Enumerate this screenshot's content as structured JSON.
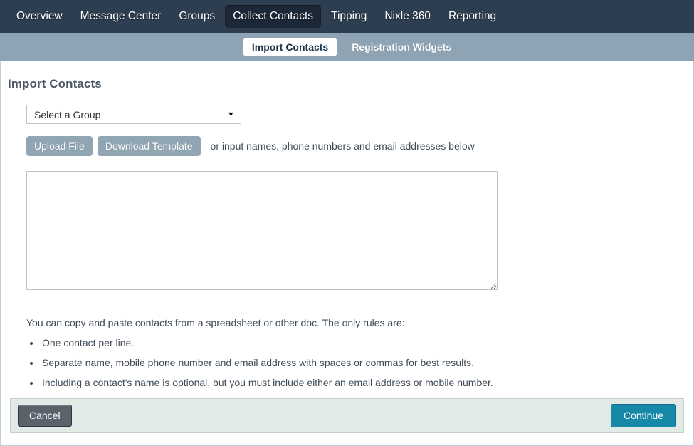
{
  "topnav": {
    "items": [
      {
        "label": "Overview",
        "active": false
      },
      {
        "label": "Message Center",
        "active": false
      },
      {
        "label": "Groups",
        "active": false
      },
      {
        "label": "Collect Contacts",
        "active": true
      },
      {
        "label": "Tipping",
        "active": false
      },
      {
        "label": "Nixle 360",
        "active": false
      },
      {
        "label": "Reporting",
        "active": false
      }
    ]
  },
  "subnav": {
    "active_tab": "Import Contacts",
    "secondary_tab": "Registration Widgets"
  },
  "main": {
    "page_title": "Import Contacts",
    "group_select": {
      "value": "Select a Group",
      "caret_icon": "chevron-down-icon"
    },
    "upload_button": "Upload File",
    "download_template_button": "Download Template",
    "hint_text": "or input names, phone numbers and email addresses below",
    "textarea": {
      "value": "",
      "placeholder": ""
    },
    "rules_intro": "You can copy and paste contacts from a spreadsheet or other doc. The only rules are:",
    "rules": [
      "One contact per line.",
      "Separate name, mobile phone number and email address with spaces or commas for best results.",
      "Including a contact's name is optional, but you must include either an email address or mobile number."
    ]
  },
  "footer": {
    "cancel_label": "Cancel",
    "continue_label": "Continue"
  },
  "colors": {
    "topnav_bg": "#2c3e50",
    "topnav_active_bg": "#1b2838",
    "subnav_bg": "#8ea4b5",
    "slate_button": "#91a6b3",
    "continue_button": "#1789a8",
    "cancel_button": "#5a636c",
    "footer_bg": "#e2eae7",
    "title_text": "#4c5866"
  }
}
